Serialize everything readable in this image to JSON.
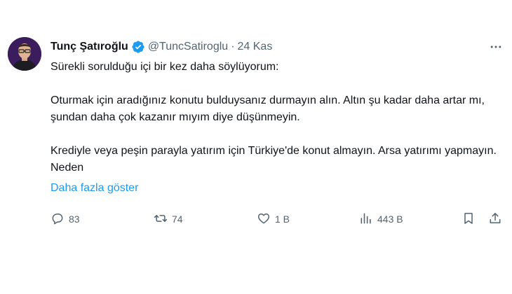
{
  "tweet": {
    "author_name": "Tunç Şatıroğlu",
    "handle": "@TuncSatiroglu",
    "separator": "·",
    "date": "24 Kas",
    "paragraphs": [
      "Sürekli sorulduğu içi bir kez daha söylüyorum:",
      "Oturmak için aradığınız konutu bulduysanız durmayın alın. Altın şu kadar daha artar mı, şundan daha çok kazanır mıyım diye düşünmeyin.",
      "Krediyle veya peşin parayla yatırım için Türkiye'de konut almayın. Arsa yatırımı yapmayın. Neden"
    ],
    "show_more": "Daha fazla göster"
  },
  "actions": {
    "replies": "83",
    "retweets": "74",
    "likes": "1 B",
    "views": "443 B"
  },
  "icons": {
    "verified": "verified-badge-icon",
    "more": "more-options-icon",
    "reply": "reply-icon",
    "retweet": "retweet-icon",
    "like": "heart-icon",
    "views": "views-icon",
    "bookmark": "bookmark-icon",
    "share": "share-icon"
  },
  "colors": {
    "link": "#1d9bf0",
    "secondary_text": "#536471",
    "primary_text": "#0f1419",
    "verified": "#1d9bf0"
  }
}
